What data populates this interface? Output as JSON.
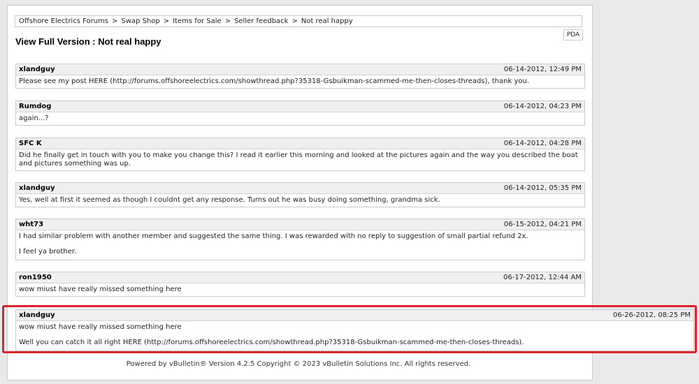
{
  "breadcrumb": [
    "Offshore Electrics Forums",
    "Swap Shop",
    "Items for Sale",
    "Seller feedback",
    "Not real happy"
  ],
  "separator": ">",
  "pda_label": "PDA",
  "page_title": "View Full Version : Not real happy",
  "posts": [
    {
      "author": "xlandguy",
      "date": "06-14-2012, 12:49 PM",
      "body": [
        "Please see my post HERE (http://forums.offshoreelectrics.com/showthread.php?35318-Gsbuikman-scammed-me-then-closes-threads), thank you."
      ]
    },
    {
      "author": "Rumdog",
      "date": "06-14-2012, 04:23 PM",
      "body": [
        "again...?"
      ]
    },
    {
      "author": "SFC K",
      "date": "06-14-2012, 04:28 PM",
      "body": [
        "Did he finally get in touch with you to make you change this? I read it earlier this morning and looked at the pictures again and the way you described the boat and pictures something was up."
      ]
    },
    {
      "author": "xlandguy",
      "date": "06-14-2012, 05:35 PM",
      "body": [
        "Yes, well at first it seemed as though I couldnt get any response. Turns out he was busy doing something, grandma sick."
      ]
    },
    {
      "author": "wht73",
      "date": "06-15-2012, 04:21 PM",
      "body": [
        "I had similar problem with another member and suggested the same thing. I was rewarded with no reply to suggestion of small partial refund 2x.",
        "I feel ya brother."
      ]
    },
    {
      "author": "ron1950",
      "date": "06-17-2012, 12:44 AM",
      "body": [
        "wow miust have really missed something here"
      ]
    },
    {
      "author": "xlandguy",
      "date": "06-26-2012, 08:25 PM",
      "body": [
        "wow miust have really missed something here",
        "Well you can catch it all right HERE (http://forums.offshoreelectrics.com/showthread.php?35318-Gsbuikman-scammed-me-then-closes-threads)."
      ]
    }
  ],
  "footer": "Powered by vBulletin® Version 4.2.5 Copyright © 2023 vBulletin Solutions Inc. All rights reserved.",
  "colors": {
    "highlight": "#d9252b",
    "header_bg": "#efefef",
    "border": "#c9c9c9"
  }
}
